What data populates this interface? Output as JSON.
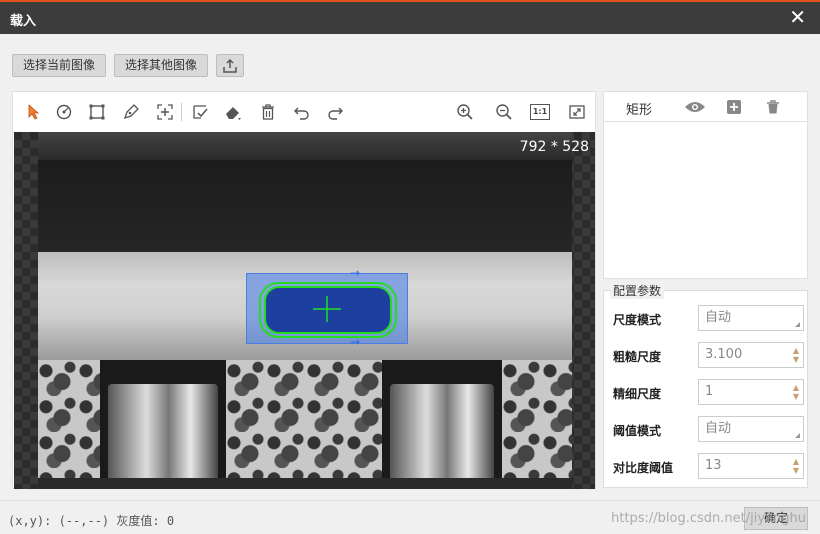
{
  "window": {
    "title": "载入",
    "close_icon": "close-icon"
  },
  "top_buttons": {
    "select_current": "选择当前图像",
    "select_other": "选择其他图像",
    "upload_icon": "upload-icon"
  },
  "toolbar": {
    "tools": [
      "pointer-icon",
      "circle-tool-icon",
      "rect-tool-icon",
      "pen-tool-icon",
      "crosshair-tool-icon",
      "check-edit-icon",
      "eraser-icon",
      "trash-icon",
      "undo-icon",
      "redo-icon",
      "zoom-in-icon",
      "zoom-out-icon",
      "actual-size-icon",
      "fit-icon"
    ],
    "actual_size_label": "1:1"
  },
  "canvas": {
    "dimensions": "792 * 528"
  },
  "shape_list": {
    "shape_label": "矩形"
  },
  "params": {
    "legend": "配置参数",
    "rows": [
      {
        "label": "尺度模式",
        "value": "自动",
        "kind": "select"
      },
      {
        "label": "粗糙尺度",
        "value": "3.100",
        "kind": "spin"
      },
      {
        "label": "精细尺度",
        "value": "1",
        "kind": "spin"
      },
      {
        "label": "阈值模式",
        "value": "自动",
        "kind": "select"
      },
      {
        "label": "对比度阈值",
        "value": "13",
        "kind": "spin"
      }
    ]
  },
  "status": {
    "coords": "(x,y): (--,--) 灰度值: 0"
  },
  "footer": {
    "ok": "确定",
    "watermark": "https://blog.csdn.net/jiyanghu"
  },
  "colors": {
    "title_bg": "#3c3c3c",
    "accent": "#e0531f",
    "roi": "#4a7fe0",
    "contour": "#22dd22"
  }
}
